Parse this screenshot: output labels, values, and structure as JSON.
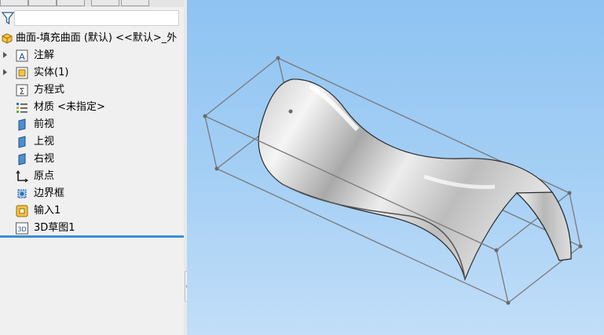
{
  "feature_tree": {
    "root": {
      "label": "曲面-填充曲面 (默认) <<默认>_外",
      "icon": "part-icon"
    },
    "items": [
      {
        "label": "注解",
        "icon": "annotations-icon",
        "expandable": true
      },
      {
        "label": "实体(1)",
        "icon": "solid-bodies-icon",
        "expandable": true
      },
      {
        "label": "方程式",
        "icon": "equations-icon",
        "expandable": false
      },
      {
        "label": "材质 <未指定>",
        "icon": "material-icon",
        "expandable": false
      },
      {
        "label": "前视",
        "icon": "plane-icon",
        "expandable": false
      },
      {
        "label": "上视",
        "icon": "plane-icon",
        "expandable": false
      },
      {
        "label": "右视",
        "icon": "plane-icon",
        "expandable": false
      },
      {
        "label": "原点",
        "icon": "origin-icon",
        "expandable": false
      },
      {
        "label": "边界框",
        "icon": "bounding-box-icon",
        "expandable": false
      },
      {
        "label": "输入1",
        "icon": "imported-feature-icon",
        "expandable": false
      },
      {
        "label": "3D草图1",
        "icon": "3d-sketch-icon",
        "expandable": false
      }
    ]
  },
  "colors": {
    "panel_bg": "#f0f0f0",
    "viewport_top": "#8ec3f2",
    "viewport_bottom": "#c2def8",
    "selection_line": "#3b8fd6",
    "bounding_box": "#7a7a7a"
  }
}
